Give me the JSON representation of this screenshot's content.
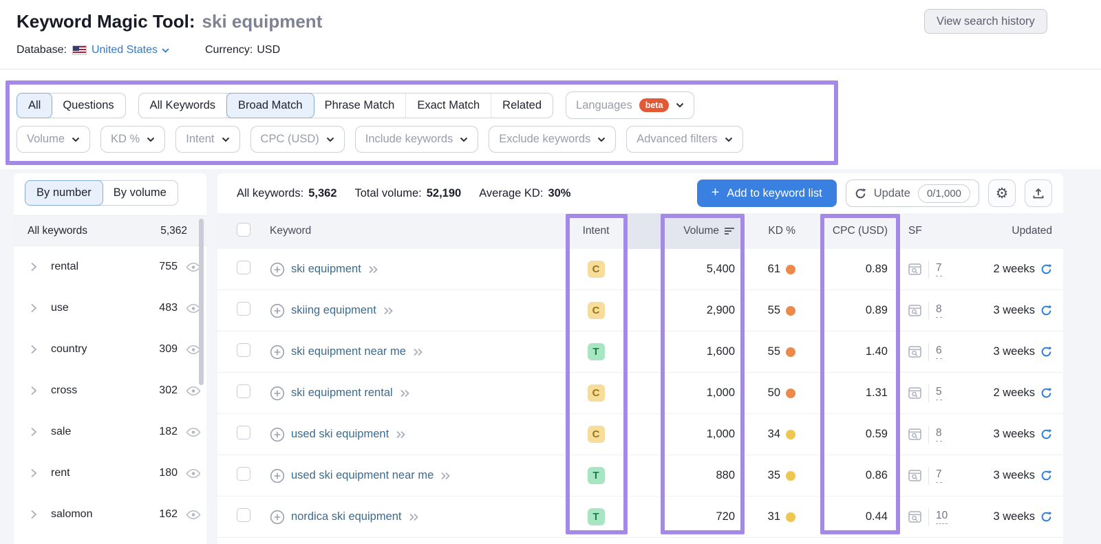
{
  "header": {
    "title": "Keyword Magic Tool:",
    "query": "ski equipment",
    "view_history_label": "View search history",
    "database_label": "Database:",
    "database_value": "United States",
    "currency_label": "Currency:",
    "currency_value": "USD"
  },
  "filters": {
    "scope_tabs": [
      {
        "label": "All",
        "selected": true
      },
      {
        "label": "Questions",
        "selected": false
      }
    ],
    "match_tabs": [
      {
        "label": "All Keywords",
        "selected": false
      },
      {
        "label": "Broad Match",
        "selected": true
      },
      {
        "label": "Phrase Match",
        "selected": false
      },
      {
        "label": "Exact Match",
        "selected": false
      },
      {
        "label": "Related",
        "selected": false
      }
    ],
    "languages_label": "Languages",
    "languages_badge": "beta",
    "dropdown_filters": [
      {
        "label": "Volume"
      },
      {
        "label": "KD %"
      },
      {
        "label": "Intent"
      },
      {
        "label": "CPC (USD)"
      },
      {
        "label": "Include keywords"
      },
      {
        "label": "Exclude keywords"
      },
      {
        "label": "Advanced filters"
      }
    ]
  },
  "sidebar": {
    "tabs": [
      {
        "label": "By number",
        "selected": true
      },
      {
        "label": "By volume",
        "selected": false
      }
    ],
    "all_keywords": {
      "label": "All keywords",
      "count": "5,362"
    },
    "groups": [
      {
        "label": "rental",
        "count": "755"
      },
      {
        "label": "use",
        "count": "483"
      },
      {
        "label": "country",
        "count": "309"
      },
      {
        "label": "cross",
        "count": "302"
      },
      {
        "label": "sale",
        "count": "182"
      },
      {
        "label": "rent",
        "count": "180"
      },
      {
        "label": "salomon",
        "count": "162"
      }
    ]
  },
  "toolbar": {
    "stats": [
      {
        "label": "All keywords:",
        "value": "5,362"
      },
      {
        "label": "Total volume:",
        "value": "52,190"
      },
      {
        "label": "Average KD:",
        "value": "30%"
      }
    ],
    "add_to_list_label": "Add to keyword list",
    "update_label": "Update",
    "update_quota": "0/1,000"
  },
  "table": {
    "headers": {
      "keyword": "Keyword",
      "intent": "Intent",
      "volume": "Volume",
      "kd": "KD %",
      "cpc": "CPC (USD)",
      "sf": "SF",
      "updated": "Updated"
    },
    "rows": [
      {
        "keyword": "ski equipment",
        "intent": "C",
        "intent_type": "commercial",
        "volume": "5,400",
        "kd": "61",
        "kd_level": "difficult",
        "cpc": "0.89",
        "sf": "7",
        "updated": "2 weeks"
      },
      {
        "keyword": "skiing equipment",
        "intent": "C",
        "intent_type": "commercial",
        "volume": "2,900",
        "kd": "55",
        "kd_level": "difficult",
        "cpc": "0.89",
        "sf": "8",
        "updated": "3 weeks"
      },
      {
        "keyword": "ski equipment near me",
        "intent": "T",
        "intent_type": "transactional",
        "volume": "1,600",
        "kd": "55",
        "kd_level": "difficult",
        "cpc": "1.40",
        "sf": "6",
        "updated": "3 weeks"
      },
      {
        "keyword": "ski equipment rental",
        "intent": "C",
        "intent_type": "commercial",
        "volume": "1,000",
        "kd": "50",
        "kd_level": "difficult",
        "cpc": "1.31",
        "sf": "5",
        "updated": "2 weeks"
      },
      {
        "keyword": "used ski equipment",
        "intent": "C",
        "intent_type": "commercial",
        "volume": "1,000",
        "kd": "34",
        "kd_level": "possible",
        "cpc": "0.59",
        "sf": "8",
        "updated": "3 weeks"
      },
      {
        "keyword": "used ski equipment near me",
        "intent": "T",
        "intent_type": "transactional",
        "volume": "880",
        "kd": "35",
        "kd_level": "possible",
        "cpc": "0.86",
        "sf": "7",
        "updated": "3 weeks"
      },
      {
        "keyword": "nordica ski equipment",
        "intent": "T",
        "intent_type": "transactional",
        "volume": "720",
        "kd": "31",
        "kd_level": "possible",
        "cpc": "0.44",
        "sf": "10",
        "updated": "3 weeks"
      }
    ]
  },
  "colors": {
    "annotation_purple": "#a489e6",
    "accent_blue": "#3a80e0",
    "intent_commercial_bg": "#f6dd9c",
    "intent_transactional_bg": "#a8e6c3",
    "kd_difficult_dot": "#ec8a4b",
    "kd_possible_dot": "#efc64f"
  }
}
